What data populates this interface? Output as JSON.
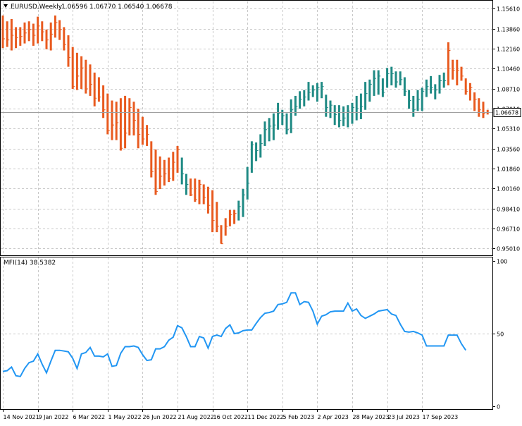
{
  "header": {
    "symbol": "EURUSD,Weekly",
    "ohlc": "1.06596 1.06770 1.06540 1.06678"
  },
  "indicator": {
    "label": "MFI(14) 38.5382"
  },
  "colors": {
    "bull": "#1f8a84",
    "bear": "#e85a1f",
    "mfi_line": "#2196f3",
    "grid": "#c8c8c8",
    "price_tag_bg": "#ffffff"
  },
  "chart_data": [
    {
      "type": "ohlc",
      "title": "EURUSD,Weekly",
      "ylim": [
        0.9441,
        1.1621
      ],
      "y_ticks": [
        "1.15610",
        "1.13860",
        "1.12160",
        "1.10460",
        "1.08710",
        "1.07010",
        "1.05310",
        "1.03560",
        "1.01860",
        "1.00160",
        "0.98410",
        "0.96710",
        "0.95010"
      ],
      "current_price": "1.06678",
      "x_ticks": [
        "14 Nov 2021",
        "9 Jan 2022",
        "6 Mar 2022",
        "1 May 2022",
        "26 Jun 2022",
        "21 Aug 2022",
        "16 Oct 2022",
        "11 Dec 2022",
        "5 Feb 2023",
        "2 Apr 2023",
        "28 May 2023",
        "23 Jul 2023",
        "17 Sep 2023"
      ],
      "bar_direction": [
        "bear",
        "bear",
        "bear",
        "bear",
        "bear",
        "bear",
        "bear",
        "bear",
        "bear",
        "bear",
        "bear",
        "bear",
        "bear",
        "bear",
        "bear",
        "bear",
        "bear",
        "bear",
        "bear",
        "bear",
        "bear",
        "bear",
        "bear",
        "bear",
        "bear",
        "bear",
        "bear",
        "bear",
        "bear",
        "bear",
        "bear",
        "bear",
        "bear",
        "bear",
        "bear",
        "bear",
        "bear",
        "bear",
        "bear",
        "bear",
        "bear",
        "bull",
        "bull",
        "bear",
        "bear",
        "bear",
        "bear",
        "bear",
        "bear",
        "bear",
        "bear",
        "bear",
        "bear",
        "bear",
        "bull",
        "bull",
        "bull",
        "bull",
        "bull",
        "bull",
        "bull",
        "bull",
        "bull",
        "bull",
        "bull",
        "bull",
        "bull",
        "bull",
        "bull",
        "bull",
        "bull",
        "bull",
        "bull",
        "bull",
        "bull",
        "bull",
        "bull",
        "bull",
        "bull",
        "bull",
        "bull",
        "bull",
        "bull",
        "bull",
        "bull",
        "bull",
        "bull",
        "bull",
        "bull",
        "bull",
        "bull",
        "bull",
        "bull",
        "bull",
        "bull",
        "bull",
        "bull",
        "bull",
        "bull",
        "bull",
        "bull",
        "bull",
        "bear",
        "bear",
        "bear",
        "bear",
        "bear",
        "bear",
        "bear",
        "bear",
        "bear",
        "bear",
        "bear"
      ],
      "close": [
        1.13,
        1.129,
        1.133,
        1.131,
        1.132,
        1.135,
        1.138,
        1.133,
        1.141,
        1.136,
        1.129,
        1.134,
        1.144,
        1.138,
        1.125,
        1.114,
        1.089,
        1.098,
        1.105,
        1.087,
        1.091,
        1.079,
        1.08,
        1.069,
        1.051,
        1.056,
        1.058,
        1.036,
        1.049,
        1.071,
        1.06,
        1.048,
        1.044,
        1.048,
        1.016,
        0.999,
        1.012,
        1.014,
        1.01,
        1.024,
        1.035,
        1.014,
        1.005,
        0.996,
        0.992,
        1.005,
        0.994,
        0.987,
        0.974,
        0.969,
        0.954,
        0.969,
        0.979,
        0.98,
        0.986,
        0.996,
        1.006,
        1.039,
        1.034,
        1.04,
        1.052,
        1.055,
        1.056,
        1.066,
        1.064,
        1.052,
        1.069,
        1.072,
        1.078,
        1.08,
        1.084,
        1.086,
        1.088,
        1.089,
        1.071,
        1.073,
        1.065,
        1.06,
        1.062,
        1.068,
        1.071,
        1.07,
        1.072,
        1.083,
        1.091,
        1.096,
        1.098,
        1.084,
        1.1,
        1.1,
        1.093,
        1.095,
        1.085,
        1.077,
        1.069,
        1.078,
        1.085,
        1.089,
        1.088,
        1.086,
        1.094,
        1.094,
        1.12,
        1.103,
        1.103,
        1.098,
        1.085,
        1.088,
        1.078,
        1.069,
        1.066,
        1.06678
      ],
      "high": [
        1.15,
        1.145,
        1.147,
        1.14,
        1.14,
        1.144,
        1.145,
        1.143,
        1.149,
        1.145,
        1.138,
        1.144,
        1.15,
        1.146,
        1.14,
        1.133,
        1.123,
        1.118,
        1.115,
        1.112,
        1.108,
        1.101,
        1.097,
        1.09,
        1.083,
        1.077,
        1.076,
        1.079,
        1.081,
        1.079,
        1.076,
        1.07,
        1.063,
        1.056,
        1.042,
        1.035,
        1.029,
        1.026,
        1.028,
        1.033,
        1.038,
        1.028,
        1.014,
        1.01,
        1.01,
        1.009,
        1.005,
        1.003,
        1.0,
        0.99,
        0.97,
        0.976,
        0.983,
        0.983,
        0.991,
        1.001,
        1.02,
        1.042,
        1.041,
        1.048,
        1.059,
        1.062,
        1.066,
        1.075,
        1.069,
        1.066,
        1.078,
        1.081,
        1.085,
        1.086,
        1.093,
        1.09,
        1.092,
        1.093,
        1.082,
        1.077,
        1.073,
        1.073,
        1.072,
        1.073,
        1.075,
        1.081,
        1.083,
        1.093,
        1.095,
        1.103,
        1.103,
        1.096,
        1.105,
        1.106,
        1.102,
        1.102,
        1.097,
        1.086,
        1.081,
        1.086,
        1.088,
        1.095,
        1.098,
        1.091,
        1.099,
        1.101,
        1.127,
        1.112,
        1.112,
        1.106,
        1.096,
        1.092,
        1.084,
        1.079,
        1.076,
        1.069
      ],
      "low": [
        1.122,
        1.123,
        1.12,
        1.122,
        1.124,
        1.126,
        1.128,
        1.124,
        1.126,
        1.128,
        1.121,
        1.12,
        1.131,
        1.129,
        1.12,
        1.106,
        1.087,
        1.086,
        1.087,
        1.083,
        1.081,
        1.072,
        1.076,
        1.062,
        1.048,
        1.043,
        1.043,
        1.034,
        1.036,
        1.047,
        1.047,
        1.036,
        1.039,
        1.038,
        1.011,
        0.996,
        1.001,
        1.004,
        1.007,
        1.008,
        1.015,
        1.005,
        0.996,
        0.995,
        0.99,
        0.988,
        0.988,
        0.98,
        0.964,
        0.964,
        0.954,
        0.961,
        0.969,
        0.971,
        0.974,
        0.977,
        0.992,
        1.015,
        1.025,
        1.028,
        1.038,
        1.042,
        1.043,
        1.052,
        1.056,
        1.048,
        1.049,
        1.064,
        1.07,
        1.072,
        1.077,
        1.08,
        1.076,
        1.079,
        1.063,
        1.062,
        1.056,
        1.054,
        1.055,
        1.054,
        1.057,
        1.06,
        1.061,
        1.069,
        1.076,
        1.081,
        1.082,
        1.08,
        1.088,
        1.09,
        1.088,
        1.09,
        1.081,
        1.07,
        1.063,
        1.068,
        1.068,
        1.08,
        1.083,
        1.078,
        1.083,
        1.088,
        1.09,
        1.095,
        1.09,
        1.094,
        1.082,
        1.077,
        1.068,
        1.063,
        1.062,
        1.065
      ]
    },
    {
      "type": "line",
      "title": "MFI(14) 38.5382",
      "ylim": [
        0,
        100
      ],
      "y_ticks": [
        "100",
        "50",
        "0"
      ],
      "series": [
        {
          "name": "MFI(14)",
          "values": [
            24.0,
            24.5,
            27.0,
            21.0,
            20.5,
            26.0,
            30.0,
            31.0,
            36.0,
            29.0,
            23.0,
            31.0,
            38.5,
            38.5,
            38.0,
            37.5,
            33.0,
            26.0,
            36.0,
            37.0,
            40.5,
            34.5,
            34.5,
            34.0,
            36.0,
            27.5,
            28.0,
            36.5,
            41.0,
            41.0,
            41.5,
            40.5,
            35.5,
            31.5,
            32.0,
            39.5,
            39.5,
            41.0,
            45.5,
            47.5,
            55.5,
            54.0,
            48.0,
            41.0,
            41.0,
            48.0,
            47.0,
            40.0,
            48.0,
            49.0,
            48.0,
            53.5,
            56.0,
            50.0,
            50.5,
            52.0,
            52.5,
            52.5,
            57.0,
            61.0,
            64.0,
            64.5,
            65.5,
            70.0,
            70.5,
            71.5,
            78.0,
            78.0,
            70.0,
            72.0,
            71.5,
            65.5,
            56.5,
            62.0,
            63.0,
            65.0,
            65.5,
            65.5,
            65.5,
            71.0,
            65.5,
            67.0,
            62.5,
            60.5,
            62.0,
            63.5,
            65.5,
            66.0,
            66.5,
            63.5,
            62.5,
            56.5,
            51.5,
            51.0,
            51.5,
            50.5,
            49.0,
            41.5,
            41.5,
            41.5,
            41.5,
            41.5,
            49.0,
            49.0,
            49.0,
            43.0,
            38.5382
          ]
        }
      ]
    }
  ]
}
